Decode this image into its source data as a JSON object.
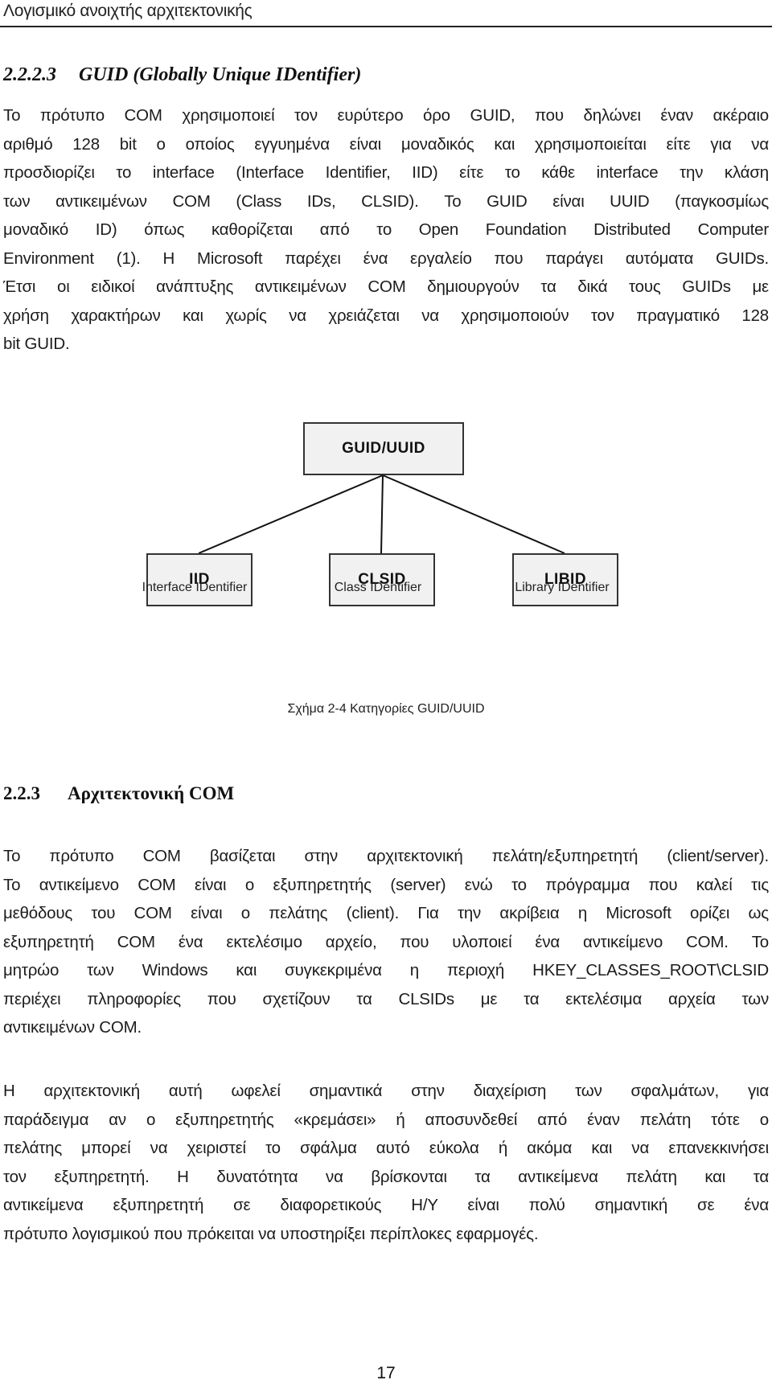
{
  "running_header": "Λογισμικό ανοιχτής αρχιτεκτονικής",
  "section_guid": {
    "number": "2.2.2.3",
    "title": "GUID (Globally Unique IDentifier)",
    "paragraph_lines": [
      "Το πρότυπο COM χρησιμοποιεί τον ευρύτερο όρο GUID, που δηλώνει έναν ακέραιο",
      "αριθμό 128 bit ο οποίος εγγυημένα είναι μοναδικός και χρησιμοποιείται είτε για να",
      "προσδιορίζει το interface (Interface Identifier, IID) είτε το κάθε interface την κλάση",
      "των αντικειμένων COM (Class IDs, CLSID). Το GUID είναι UUID (παγκοσμίως",
      "μοναδικό ID) όπως καθορίζεται από το Open Foundation Distributed Computer",
      "Environment (1). Η Microsoft παρέχει ένα εργαλείο που παράγει αυτόματα GUIDs.",
      "Έτσι οι ειδικοί ανάπτυξης αντικειμένων COM δημιουργούν τα δικά τους GUIDs με",
      "χρήση χαρακτήρων και χωρίς να χρειάζεται να χρησιμοποιούν τον πραγματικό 128",
      "bit GUID."
    ]
  },
  "figure": {
    "root": "GUID/UUID",
    "children": [
      {
        "box": "IID",
        "label": "Interface IDentifier"
      },
      {
        "box": "CLSID",
        "label": "Class IDentifier"
      },
      {
        "box": "LIBID",
        "label": "Library IDentifier"
      }
    ],
    "caption": "Σχήμα 2-4 Κατηγορίες GUID/UUID"
  },
  "section_com": {
    "number": "2.2.3",
    "title": "Αρχιτεκτονική COM",
    "paragraph1_lines": [
      "Το πρότυπο COM βασίζεται στην αρχιτεκτονική πελάτη/εξυπηρετητή (client/server).",
      "Το αντικείμενο COM είναι ο εξυπηρετητής (server) ενώ το πρόγραμμα που καλεί τις",
      "μεθόδους του COM είναι ο πελάτης (client). Για την ακρίβεια η Microsoft ορίζει ως",
      "εξυπηρετητή COM ένα εκτελέσιμο αρχείο, που υλοποιεί ένα αντικείμενο COM. Το",
      "μητρώο των Windows και συγκεκριμένα η περιοχή HKEY_CLASSES_ROOT\\CLSID",
      "περιέχει πληροφορίες που σχετίζουν τα CLSIDs με τα εκτελέσιμα αρχεία των",
      "αντικειμένων COM."
    ],
    "paragraph2_lines": [
      "Η αρχιτεκτονική αυτή ωφελεί σημαντικά στην διαχείριση των σφαλμάτων, για",
      "παράδειγμα αν ο εξυπηρετητής «κρεμάσει» ή αποσυνδεθεί από έναν πελάτη τότε ο",
      "πελάτης μπορεί να χειριστεί το σφάλμα αυτό εύκολα ή ακόμα και να επανεκκινήσει",
      "τον εξυπηρετητή. Η δυνατότητα να βρίσκονται τα αντικείμενα πελάτη και τα",
      "αντικείμενα εξυπηρετητή σε διαφορετικούς Η/Υ είναι πολύ σημαντική σε ένα",
      "πρότυπο λογισμικού που πρόκειται να υποστηρίξει περίπλοκες εφαρμογές."
    ]
  },
  "page_number": "17"
}
